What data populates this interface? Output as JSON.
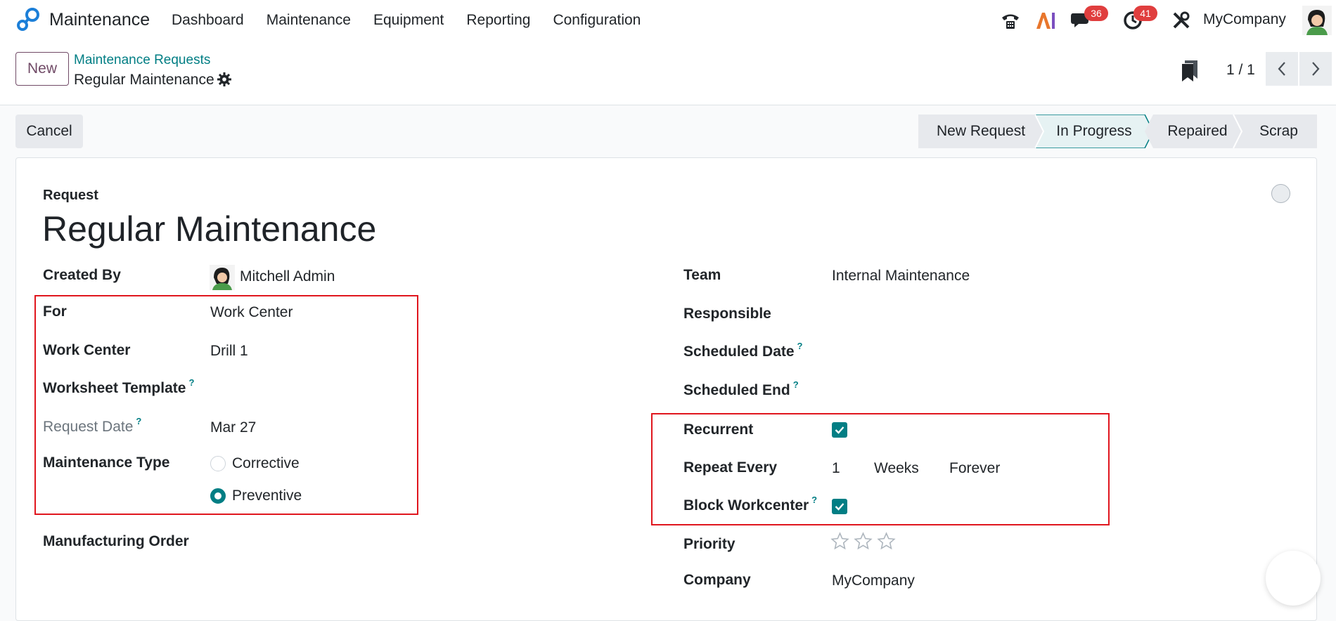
{
  "navbar": {
    "app_name": "Maintenance",
    "menu": [
      "Dashboard",
      "Maintenance",
      "Equipment",
      "Reporting",
      "Configuration"
    ],
    "messages_count": "36",
    "activities_count": "41",
    "company": "MyCompany",
    "colors": {
      "brand": "#017e84",
      "badge": "#e03e3e",
      "primary": "#714b67"
    }
  },
  "control": {
    "new_label": "New",
    "breadcrumb_parent": "Maintenance Requests",
    "breadcrumb_current": "Regular Maintenance",
    "pager": "1 / 1"
  },
  "status": {
    "cancel_label": "Cancel",
    "stages": [
      "New Request",
      "In Progress",
      "Repaired",
      "Scrap"
    ],
    "active_stage": "In Progress"
  },
  "form": {
    "request_label": "Request",
    "title": "Regular Maintenance",
    "left": {
      "created_by_label": "Created By",
      "created_by_value": "Mitchell Admin",
      "for_label": "For",
      "for_value": "Work Center",
      "work_center_label": "Work Center",
      "work_center_value": "Drill 1",
      "worksheet_label": "Worksheet Template",
      "request_date_label": "Request Date",
      "request_date_value": "Mar 27",
      "maintenance_type_label": "Maintenance Type",
      "type_options": [
        "Corrective",
        "Preventive"
      ],
      "type_selected": "Preventive",
      "mo_label": "Manufacturing Order"
    },
    "right": {
      "team_label": "Team",
      "team_value": "Internal Maintenance",
      "responsible_label": "Responsible",
      "scheduled_date_label": "Scheduled Date",
      "scheduled_end_label": "Scheduled End",
      "recurrent_label": "Recurrent",
      "recurrent_checked": true,
      "repeat_label": "Repeat Every",
      "repeat_interval": "1",
      "repeat_unit": "Weeks",
      "repeat_type": "Forever",
      "block_label": "Block Workcenter",
      "block_checked": true,
      "priority_label": "Priority",
      "priority_stars": 0,
      "company_label": "Company",
      "company_value": "MyCompany"
    },
    "help_mark": "?"
  }
}
